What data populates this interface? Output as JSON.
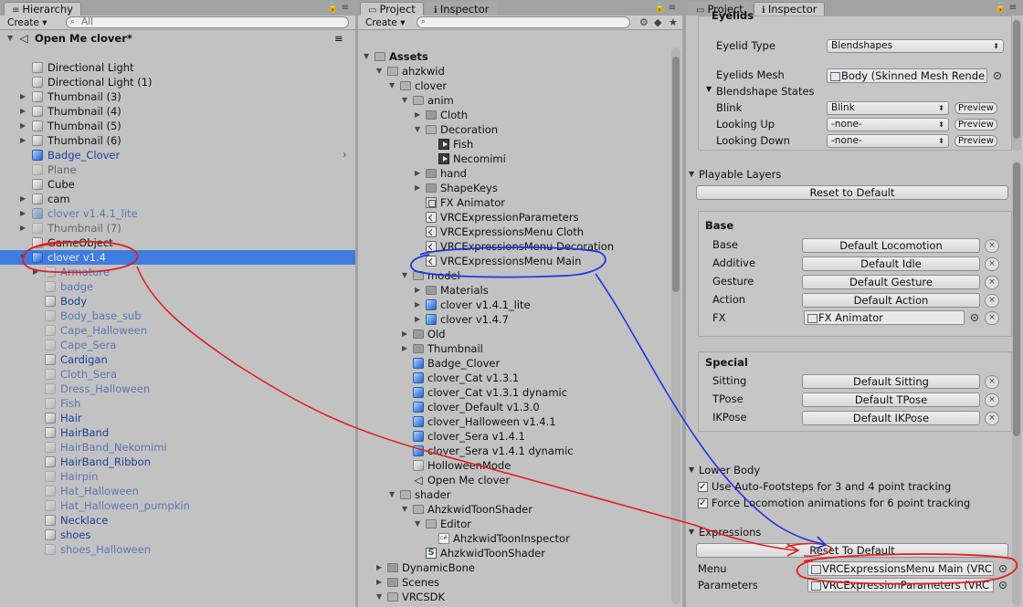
{
  "hierarchy": {
    "tab": "Hierarchy",
    "create": "Create",
    "search_placeholder": "All",
    "scene_name": "Open Me clover*",
    "items": [
      {
        "label": "Directional Light",
        "depth": 1,
        "icon": "gameobject-icon",
        "style": "normal",
        "arrow": ""
      },
      {
        "label": "Directional Light (1)",
        "depth": 1,
        "icon": "gameobject-icon",
        "style": "normal",
        "arrow": ""
      },
      {
        "label": "Thumbnail (3)",
        "depth": 1,
        "icon": "gameobject-icon",
        "style": "normal",
        "arrow": "collapsed"
      },
      {
        "label": "Thumbnail (4)",
        "depth": 1,
        "icon": "gameobject-icon",
        "style": "normal",
        "arrow": "collapsed"
      },
      {
        "label": "Thumbnail (5)",
        "depth": 1,
        "icon": "gameobject-icon",
        "style": "normal",
        "arrow": "collapsed"
      },
      {
        "label": "Thumbnail (6)",
        "depth": 1,
        "icon": "gameobject-icon",
        "style": "normal",
        "arrow": "collapsed"
      },
      {
        "label": "Badge_Clover",
        "depth": 1,
        "icon": "prefab-icon",
        "style": "prefab",
        "arrow": ""
      },
      {
        "label": "Plane",
        "depth": 1,
        "icon": "gameobject-faint-icon",
        "style": "dim",
        "arrow": ""
      },
      {
        "label": "Cube",
        "depth": 1,
        "icon": "gameobject-icon",
        "style": "normal",
        "arrow": ""
      },
      {
        "label": "cam",
        "depth": 1,
        "icon": "gameobject-icon",
        "style": "normal",
        "arrow": "collapsed"
      },
      {
        "label": "clover v1.4.1_lite",
        "depth": 1,
        "icon": "prefab-faint-icon",
        "style": "pdim",
        "arrow": "collapsed"
      },
      {
        "label": "Thumbnail (7)",
        "depth": 1,
        "icon": "gameobject-faint-icon",
        "style": "dim",
        "arrow": "collapsed"
      },
      {
        "label": "GameObject",
        "depth": 1,
        "icon": "gameobject-icon",
        "style": "normal",
        "arrow": ""
      },
      {
        "label": "clover v1.4",
        "depth": 1,
        "icon": "prefab-icon",
        "style": "white",
        "arrow": "expanded",
        "selected": true
      },
      {
        "label": "Armature",
        "depth": 2,
        "icon": "gameobject-faint-icon",
        "style": "pdim",
        "arrow": "collapsed"
      },
      {
        "label": "badge",
        "depth": 2,
        "icon": "gameobject-faint-icon",
        "style": "pdim",
        "arrow": ""
      },
      {
        "label": "Body",
        "depth": 2,
        "icon": "gameobject-icon",
        "style": "prefab",
        "arrow": ""
      },
      {
        "label": "Body_base_sub",
        "depth": 2,
        "icon": "gameobject-faint-icon",
        "style": "pdim",
        "arrow": ""
      },
      {
        "label": "Cape_Halloween",
        "depth": 2,
        "icon": "gameobject-faint-icon",
        "style": "pdim",
        "arrow": ""
      },
      {
        "label": "Cape_Sera",
        "depth": 2,
        "icon": "gameobject-faint-icon",
        "style": "pdim",
        "arrow": ""
      },
      {
        "label": "Cardigan",
        "depth": 2,
        "icon": "gameobject-icon",
        "style": "prefab",
        "arrow": ""
      },
      {
        "label": "Cloth_Sera",
        "depth": 2,
        "icon": "gameobject-faint-icon",
        "style": "pdim",
        "arrow": ""
      },
      {
        "label": "Dress_Halloween",
        "depth": 2,
        "icon": "gameobject-faint-icon",
        "style": "pdim",
        "arrow": ""
      },
      {
        "label": "Fish",
        "depth": 2,
        "icon": "gameobject-faint-icon",
        "style": "pdim",
        "arrow": ""
      },
      {
        "label": "Hair",
        "depth": 2,
        "icon": "gameobject-icon",
        "style": "prefab",
        "arrow": ""
      },
      {
        "label": "HairBand",
        "depth": 2,
        "icon": "gameobject-icon",
        "style": "prefab",
        "arrow": ""
      },
      {
        "label": "HairBand_Nekomimi",
        "depth": 2,
        "icon": "gameobject-faint-icon",
        "style": "pdim",
        "arrow": ""
      },
      {
        "label": "HairBand_Ribbon",
        "depth": 2,
        "icon": "gameobject-icon",
        "style": "prefab",
        "arrow": ""
      },
      {
        "label": "Hairpin",
        "depth": 2,
        "icon": "gameobject-faint-icon",
        "style": "pdim",
        "arrow": ""
      },
      {
        "label": "Hat_Halloween",
        "depth": 2,
        "icon": "gameobject-faint-icon",
        "style": "pdim",
        "arrow": ""
      },
      {
        "label": "Hat_Halloween_pumpkin",
        "depth": 2,
        "icon": "gameobject-faint-icon",
        "style": "pdim",
        "arrow": ""
      },
      {
        "label": "Necklace",
        "depth": 2,
        "icon": "gameobject-icon",
        "style": "prefab",
        "arrow": ""
      },
      {
        "label": "shoes",
        "depth": 2,
        "icon": "gameobject-icon",
        "style": "prefab",
        "arrow": ""
      },
      {
        "label": "shoes_Halloween",
        "depth": 2,
        "icon": "gameobject-faint-icon",
        "style": "pdim",
        "arrow": ""
      }
    ]
  },
  "project": {
    "tabs": [
      "Project",
      "Inspector"
    ],
    "create": "Create",
    "items": [
      {
        "label": "Assets",
        "depth": 0,
        "icon": "folder-open-icon",
        "arrow": "expanded",
        "bold": true
      },
      {
        "label": "ahzkwid",
        "depth": 1,
        "icon": "folder-open-icon",
        "arrow": "expanded"
      },
      {
        "label": "clover",
        "depth": 2,
        "icon": "folder-open-icon",
        "arrow": "expanded"
      },
      {
        "label": "anim",
        "depth": 3,
        "icon": "folder-open-icon",
        "arrow": "expanded"
      },
      {
        "label": "Cloth",
        "depth": 4,
        "icon": "folder-icon",
        "arrow": "collapsed"
      },
      {
        "label": "Decoration",
        "depth": 4,
        "icon": "folder-open-icon",
        "arrow": "expanded"
      },
      {
        "label": "Fish",
        "depth": 5,
        "icon": "animation-icon",
        "arrow": ""
      },
      {
        "label": "Necomimi",
        "depth": 5,
        "icon": "animation-icon",
        "arrow": ""
      },
      {
        "label": "hand",
        "depth": 4,
        "icon": "folder-icon",
        "arrow": "collapsed"
      },
      {
        "label": "ShapeKeys",
        "depth": 4,
        "icon": "folder-icon",
        "arrow": "collapsed"
      },
      {
        "label": "FX Animator",
        "depth": 4,
        "icon": "animator-controller-icon",
        "arrow": ""
      },
      {
        "label": "VRCExpressionParameters",
        "depth": 4,
        "icon": "scriptable-object-icon",
        "arrow": ""
      },
      {
        "label": "VRCExpressionsMenu Cloth",
        "depth": 4,
        "icon": "scriptable-object-icon",
        "arrow": ""
      },
      {
        "label": "VRCExpressionsMenu Decoration",
        "depth": 4,
        "icon": "scriptable-object-icon",
        "arrow": ""
      },
      {
        "label": "VRCExpressionsMenu Main",
        "depth": 4,
        "icon": "scriptable-object-icon",
        "arrow": ""
      },
      {
        "label": "model",
        "depth": 3,
        "icon": "folder-open-icon",
        "arrow": "expanded"
      },
      {
        "label": "Materials",
        "depth": 4,
        "icon": "folder-icon",
        "arrow": "collapsed"
      },
      {
        "label": "clover v1.4.1_lite",
        "depth": 4,
        "icon": "prefab-model-icon",
        "arrow": "collapsed"
      },
      {
        "label": "clover v1.4.7",
        "depth": 4,
        "icon": "prefab-model-icon",
        "arrow": "collapsed"
      },
      {
        "label": "Old",
        "depth": 3,
        "icon": "folder-icon",
        "arrow": "collapsed"
      },
      {
        "label": "Thumbnail",
        "depth": 3,
        "icon": "folder-icon",
        "arrow": "collapsed"
      },
      {
        "label": "Badge_Clover",
        "depth": 3,
        "icon": "prefab-icon",
        "arrow": ""
      },
      {
        "label": "clover_Cat v1.3.1",
        "depth": 3,
        "icon": "prefab-icon",
        "arrow": ""
      },
      {
        "label": "clover_Cat v1.3.1 dynamic",
        "depth": 3,
        "icon": "prefab-icon",
        "arrow": ""
      },
      {
        "label": "clover_Default v1.3.0",
        "depth": 3,
        "icon": "prefab-icon",
        "arrow": ""
      },
      {
        "label": "clover_Halloween v1.4.1",
        "depth": 3,
        "icon": "prefab-icon",
        "arrow": ""
      },
      {
        "label": "clover_Sera v1.4.1",
        "depth": 3,
        "icon": "prefab-icon",
        "arrow": ""
      },
      {
        "label": "clover_Sera v1.4.1 dynamic",
        "depth": 3,
        "icon": "prefab-icon",
        "arrow": ""
      },
      {
        "label": "HolloweenMode",
        "depth": 3,
        "icon": "gameobject-icon",
        "arrow": ""
      },
      {
        "label": "Open Me clover",
        "depth": 3,
        "icon": "unity-scene-icon",
        "arrow": ""
      },
      {
        "label": "shader",
        "depth": 2,
        "icon": "folder-open-icon",
        "arrow": "expanded"
      },
      {
        "label": "AhzkwidToonShader",
        "depth": 3,
        "icon": "folder-open-icon",
        "arrow": "expanded"
      },
      {
        "label": "Editor",
        "depth": 4,
        "icon": "folder-open-icon",
        "arrow": "expanded"
      },
      {
        "label": "AhzkwidToonInspector",
        "depth": 5,
        "icon": "csharp-script-icon",
        "arrow": ""
      },
      {
        "label": "AhzkwidToonShader",
        "depth": 4,
        "icon": "shader-icon",
        "arrow": ""
      },
      {
        "label": "DynamicBone",
        "depth": 1,
        "icon": "folder-icon",
        "arrow": "collapsed"
      },
      {
        "label": "Scenes",
        "depth": 1,
        "icon": "folder-icon",
        "arrow": "collapsed"
      },
      {
        "label": "VRCSDK",
        "depth": 1,
        "icon": "folder-open-icon",
        "arrow": "expanded"
      }
    ]
  },
  "inspector": {
    "tabs": [
      "Project",
      "Inspector"
    ],
    "eyelids": {
      "header": "Eyelids",
      "eyelid_type_label": "Eyelid Type",
      "eyelid_type_value": "Blendshapes",
      "eyelids_mesh_label": "Eyelids Mesh",
      "eyelids_mesh_value": "Body (Skinned Mesh Rende",
      "blendshape_states": "Blendshape States",
      "states": [
        {
          "label": "Blink",
          "value": "Blink",
          "preview": "Preview"
        },
        {
          "label": "Looking Up",
          "value": "-none-",
          "preview": "Preview"
        },
        {
          "label": "Looking Down",
          "value": "-none-",
          "preview": "Preview"
        }
      ]
    },
    "playable_layers": {
      "header": "Playable Layers",
      "reset": "Reset to Default",
      "base": {
        "title": "Base",
        "rows": [
          {
            "label": "Base",
            "value": "Default Locomotion"
          },
          {
            "label": "Additive",
            "value": "Default Idle"
          },
          {
            "label": "Gesture",
            "value": "Default Gesture"
          },
          {
            "label": "Action",
            "value": "Default Action"
          }
        ],
        "fx_label": "FX",
        "fx_value": "FX Animator"
      },
      "special": {
        "title": "Special",
        "rows": [
          {
            "label": "Sitting",
            "value": "Default Sitting"
          },
          {
            "label": "TPose",
            "value": "Default TPose"
          },
          {
            "label": "IKPose",
            "value": "Default IKPose"
          }
        ]
      }
    },
    "lower_body": {
      "header": "Lower Body",
      "auto_footsteps": "Use Auto-Footsteps for 3 and 4 point tracking",
      "force_locomotion": "Force Locomotion animations for 6 point tracking"
    },
    "expressions": {
      "header": "Expressions",
      "reset": "Reset To Default",
      "menu_label": "Menu",
      "menu_value": "VRCExpressionsMenu Main (VRC",
      "params_label": "Parameters",
      "params_value": "VRCExpressionParameters (VRC"
    }
  },
  "playbar": {
    "play": "▶",
    "pause": "❚❚",
    "step": "▶❚"
  },
  "glyphs": {
    "check": "✓",
    "clear": "×",
    "search": "⌕",
    "lock": "🔒",
    "menu": "≡"
  },
  "colors": {
    "selection": "#3f7ce0",
    "annotation_red": "#e02020",
    "annotation_blue": "#1f35e0"
  }
}
